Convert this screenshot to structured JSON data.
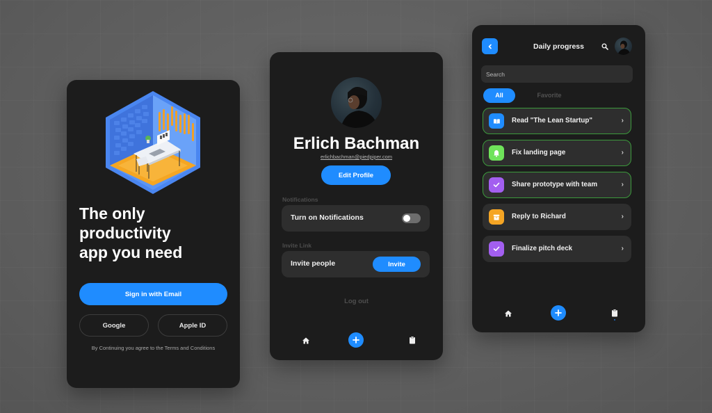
{
  "colors": {
    "accent": "#1f8cff",
    "card_bg": "#1c1c1c",
    "row_bg": "#2e2e2e",
    "done_border": "#3c9a3c"
  },
  "login": {
    "illustration": "isometric-office-room-illustration",
    "headline_lines": [
      "The only",
      "productivity",
      "app you need"
    ],
    "sign_in_email_label": "Sign in with Email",
    "google_label": "Google",
    "apple_label": "Apple ID",
    "terms_text": "By Continuing you agree to the Terms and Conditions"
  },
  "profile": {
    "name": "Erlich Bachman",
    "email": "erlichbachman@piedpiper.com",
    "edit_label": "Edit Profile",
    "notifications_section": "Notifications",
    "notifications_row": "Turn on Notifications",
    "notifications_enabled": false,
    "invite_section": "Invite Link",
    "invite_row": "Invite people",
    "invite_button": "Invite",
    "logout_label": "Log out",
    "tabbar": {
      "home_icon": "home-icon",
      "add_icon": "plus-icon",
      "clipboard_icon": "clipboard-icon"
    }
  },
  "progress": {
    "title": "Daily progress",
    "search_placeholder": "Search",
    "filters": [
      {
        "label": "All",
        "active": true
      },
      {
        "label": "Favorite",
        "active": false
      }
    ],
    "tasks": [
      {
        "label": "Read \"The Lean Startup\"",
        "icon": "book-icon",
        "color": "#1f8cff",
        "done": true
      },
      {
        "label": "Fix landing page",
        "icon": "bell-icon",
        "color": "#6fe35a",
        "done": true
      },
      {
        "label": "Share prototype with team",
        "icon": "check-icon",
        "color": "#a35ff0",
        "done": true
      },
      {
        "label": "Reply to Richard",
        "icon": "archive-icon",
        "color": "#f5a524",
        "done": false
      },
      {
        "label": "Finalize pitch deck",
        "icon": "check-icon",
        "color": "#a35ff0",
        "done": false
      }
    ],
    "chevron": "›",
    "tabbar": {
      "home_icon": "home-icon",
      "add_icon": "plus-icon",
      "clipboard_icon": "clipboard-icon"
    }
  }
}
